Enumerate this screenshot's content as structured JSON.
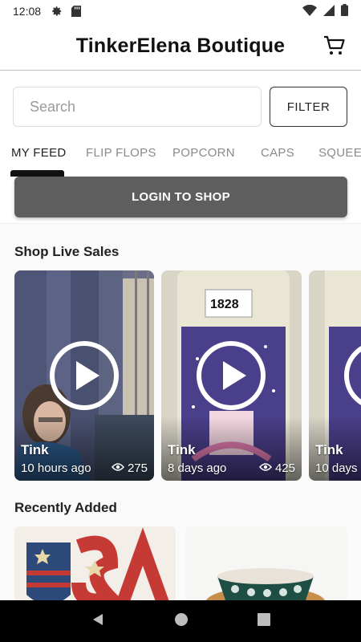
{
  "status": {
    "time": "12:08"
  },
  "header": {
    "title": "TinkerElena Boutique"
  },
  "search": {
    "placeholder": "Search",
    "value": "",
    "filter_label": "FILTER"
  },
  "tabs": [
    {
      "label": "MY FEED",
      "active": true
    },
    {
      "label": "FLIP FLOPS"
    },
    {
      "label": "POPCORN"
    },
    {
      "label": "CAPS"
    },
    {
      "label": "SQUEE"
    }
  ],
  "login": {
    "label": "LOGIN TO SHOP"
  },
  "live_sales": {
    "title": "Shop Live Sales",
    "items": [
      {
        "name": "Tink",
        "time": "10 hours ago",
        "views": "275"
      },
      {
        "name": "Tink",
        "time": "8 days ago",
        "views": "425",
        "jar_number": "1828"
      },
      {
        "name": "Tink",
        "time": "10 days"
      }
    ]
  },
  "recently_added": {
    "title": "Recently Added",
    "sign_text": "USA"
  }
}
